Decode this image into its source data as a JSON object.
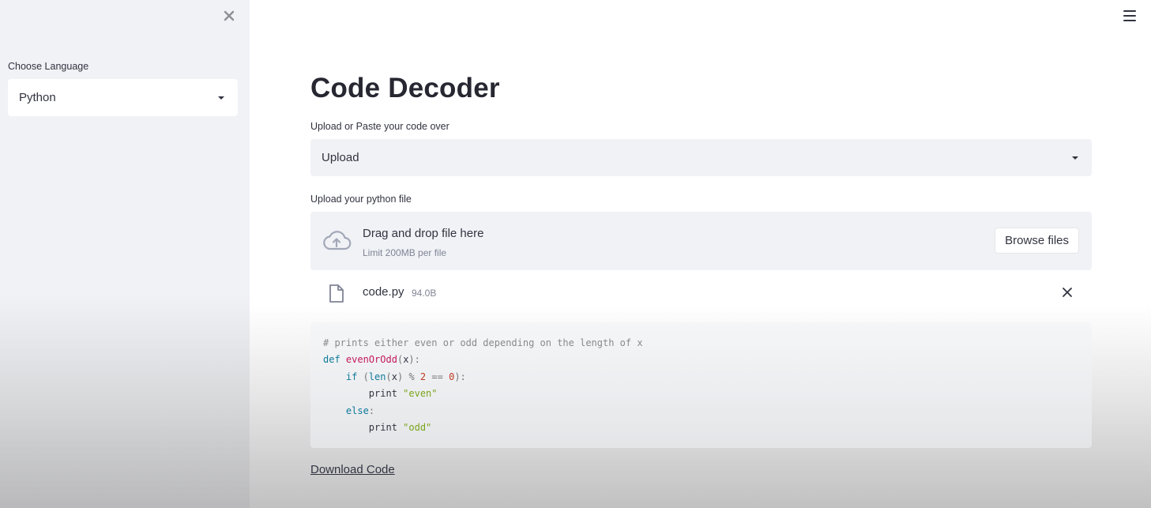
{
  "sidebar": {
    "label": "Choose Language",
    "language_value": "Python",
    "close_icon": "close-icon"
  },
  "header": {
    "menu_icon": "hamburger-menu-icon"
  },
  "main": {
    "title": "Code Decoder",
    "mode_label": "Upload or Paste your code over",
    "mode_value": "Upload",
    "upload_label": "Upload your python file",
    "dropzone": {
      "main_text": "Drag and drop file here",
      "sub_text": "Limit 200MB per file",
      "browse_label": "Browse files"
    },
    "file": {
      "name": "code.py",
      "size": "94.0B"
    },
    "code_lines": [
      "# prints either even or odd depending on the length of x",
      "def evenOrOdd(x):",
      "    if (len(x) % 2 == 0):",
      "        print \"even\"",
      "    else:",
      "        print \"odd\""
    ],
    "download_label": "Download Code"
  },
  "colors": {
    "sidebar_bg": "#f0f2f6",
    "text": "#31333f",
    "muted": "#808495",
    "keyword": "#0d7a9a",
    "function": "#c2185b",
    "string": "#7aa51a",
    "number": "#c23b22",
    "comment": "#8a8a8a"
  }
}
